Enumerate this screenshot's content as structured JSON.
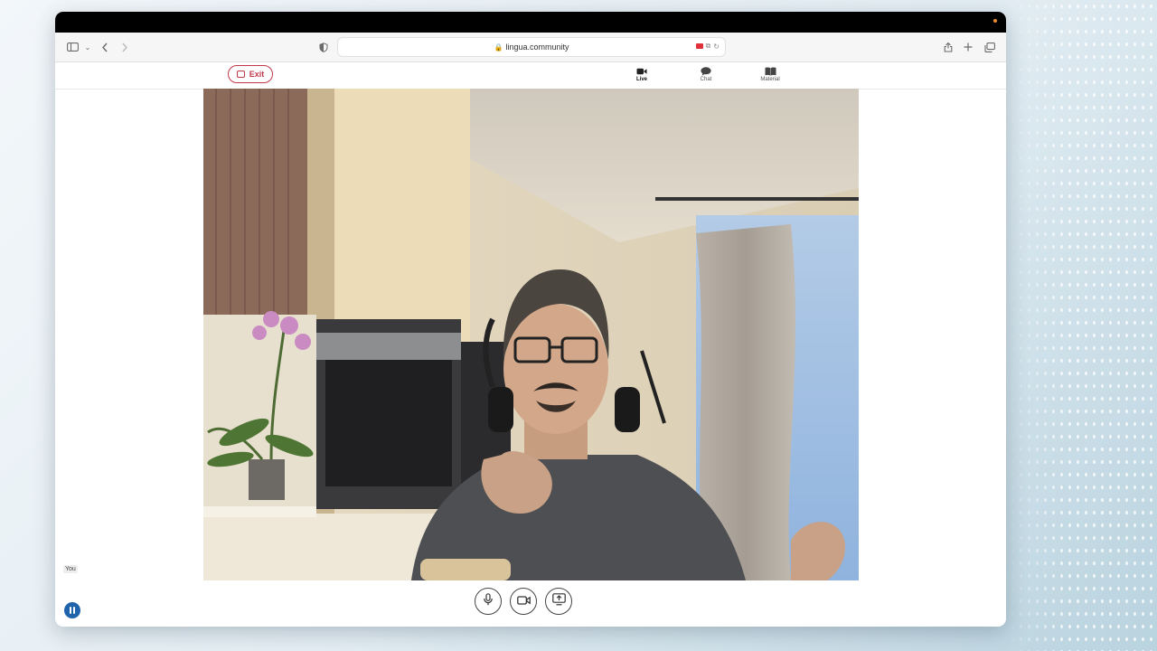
{
  "browser": {
    "url": "lingua.community"
  },
  "app": {
    "exit_label": "Exit",
    "nav": [
      {
        "label": "Live",
        "icon": "video-camera-icon",
        "active": true
      },
      {
        "label": "Chat",
        "icon": "chat-bubble-icon",
        "active": false
      },
      {
        "label": "Material",
        "icon": "book-icon",
        "active": false
      }
    ],
    "self_label": "You",
    "controls": [
      {
        "icon": "microphone-icon"
      },
      {
        "icon": "camera-icon"
      },
      {
        "icon": "share-screen-icon"
      }
    ]
  },
  "colors": {
    "exit_red": "#c0394b",
    "brand_blue": "#1f63ad",
    "record_red": "#e0303a"
  }
}
